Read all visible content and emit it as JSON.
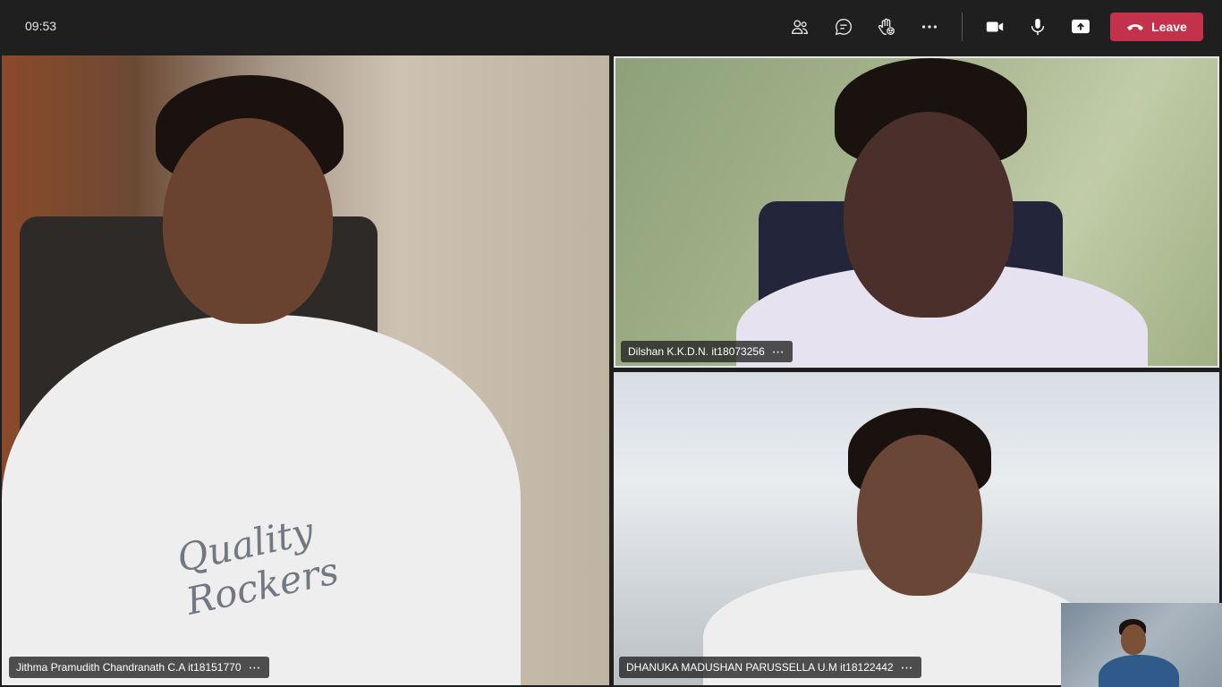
{
  "meeting": {
    "time": "09:53",
    "leave_label": "Leave",
    "toolbar_icons": [
      "people-icon",
      "chat-icon",
      "raise-hand-icon",
      "more-icon",
      "camera-icon",
      "mic-icon",
      "share-icon"
    ]
  },
  "participants": [
    {
      "name": "Jithma Pramudith Chandranath C.A it18151770",
      "more": "⋯"
    },
    {
      "name": "Dilshan K.K.D.N. it18073256",
      "more": "⋯"
    },
    {
      "name": "DHANUKA MADUSHAN PARUSSELLA U.M it18122442",
      "more": "⋯"
    }
  ],
  "colors": {
    "background": "#1f1f1f",
    "leave_button": "#c4314b",
    "active_speaker_border": "#e6e6e6"
  }
}
